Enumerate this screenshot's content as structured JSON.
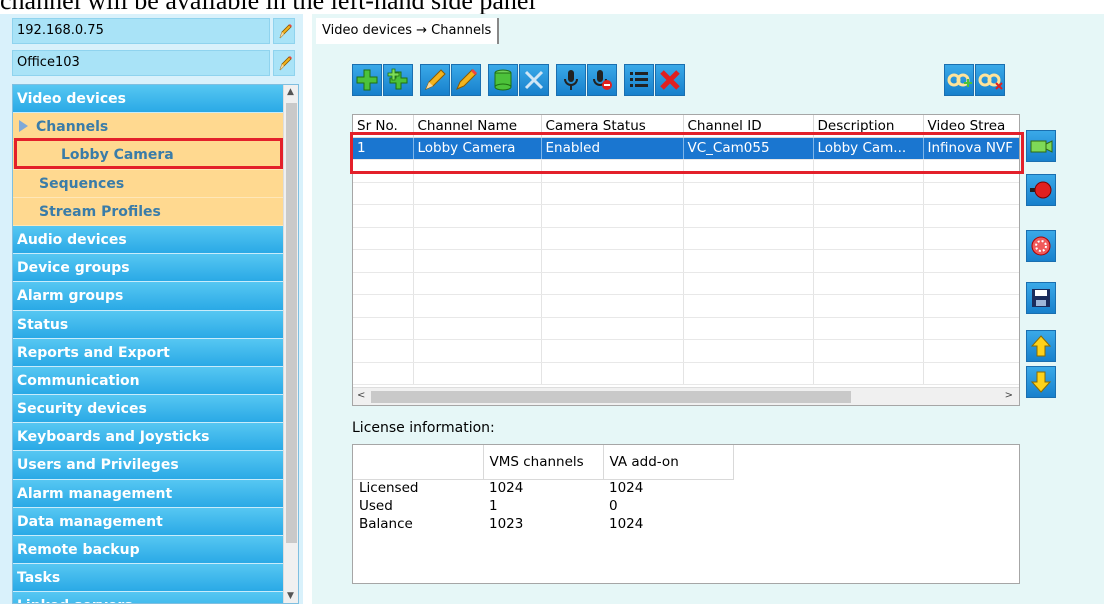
{
  "caption": "channel will be available in the left-hand side panel",
  "sidebar": {
    "server_ip": "192.168.0.75",
    "site_name": "Office103",
    "items": [
      {
        "label": "Video devices",
        "level": "top"
      },
      {
        "label": "Channels",
        "level": "sub1"
      },
      {
        "label": "Lobby Camera",
        "level": "sub2"
      },
      {
        "label": "Sequences",
        "level": "sub1b"
      },
      {
        "label": "Stream Profiles",
        "level": "sub1b"
      },
      {
        "label": "Audio devices",
        "level": "top"
      },
      {
        "label": "Device groups",
        "level": "top"
      },
      {
        "label": "Alarm groups",
        "level": "top"
      },
      {
        "label": "Status",
        "level": "top"
      },
      {
        "label": "Reports and Export",
        "level": "top"
      },
      {
        "label": "Communication",
        "level": "top"
      },
      {
        "label": "Security devices",
        "level": "top"
      },
      {
        "label": "Keyboards and Joysticks",
        "level": "top"
      },
      {
        "label": "Users and Privileges",
        "level": "top"
      },
      {
        "label": "Alarm management",
        "level": "top"
      },
      {
        "label": "Data management",
        "level": "top"
      },
      {
        "label": "Remote backup",
        "level": "top"
      },
      {
        "label": "Tasks",
        "level": "top"
      },
      {
        "label": "Linked servers",
        "level": "top"
      }
    ]
  },
  "header": {
    "breadcrumb": "Video devices → Channels"
  },
  "toolbar": {
    "icons": [
      "add-icon",
      "add-multiple-icon",
      "edit-icon",
      "edit-multiple-icon",
      "database-icon",
      "tools-icon",
      "microphone-icon",
      "microphone-disabled-icon",
      "list-icon",
      "delete-icon",
      "link-add-icon",
      "link-remove-icon"
    ]
  },
  "channels_table": {
    "columns": [
      "Sr No.",
      "Channel Name",
      "Camera Status",
      "Channel ID",
      "Description",
      "Video Strea"
    ],
    "rows": [
      [
        "1",
        "Lobby Camera",
        "Enabled",
        "VC_Cam055",
        "Lobby Cam...",
        "Infinova NVF"
      ]
    ],
    "selected_row": 0
  },
  "side_buttons": {
    "icons": [
      "camera-link-icon",
      "record-icon",
      "stop-icon",
      "save-icon",
      "move-up-icon",
      "move-down-icon"
    ]
  },
  "license": {
    "title": "License information:",
    "columns": [
      "",
      "VMS channels",
      "VA add-on"
    ],
    "rows": [
      [
        "Licensed",
        "1024",
        "1024"
      ],
      [
        "Used",
        "1",
        "0"
      ],
      [
        "Balance",
        "1023",
        "1024"
      ]
    ]
  },
  "colors": {
    "highlight": "#e3202a",
    "selection": "#1a76d0",
    "menu_blue": "#2aa9e6",
    "menu_sub": "#ffd990"
  }
}
